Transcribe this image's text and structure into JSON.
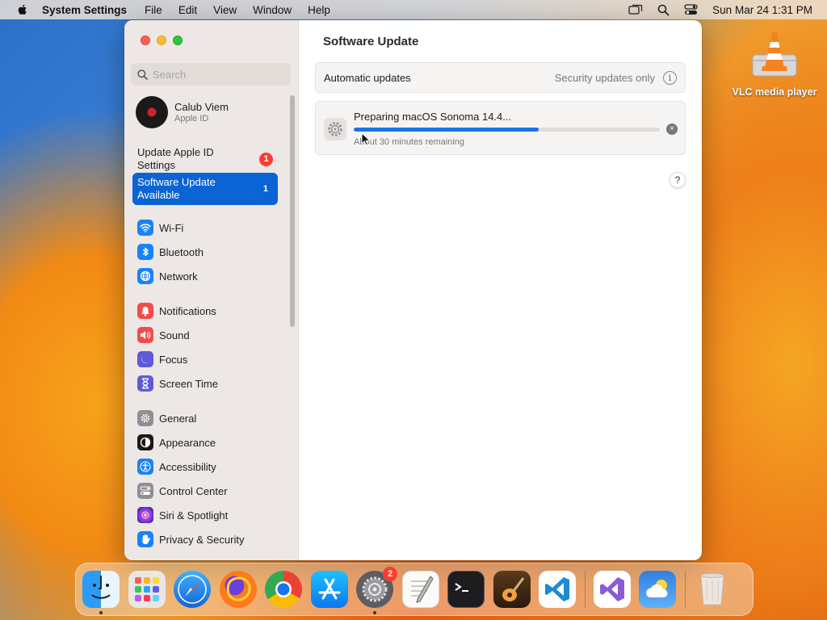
{
  "menubar": {
    "app_name": "System Settings",
    "items": [
      "File",
      "Edit",
      "View",
      "Window",
      "Help"
    ],
    "datetime": "Sun Mar 24  1:31 PM"
  },
  "desktop": {
    "icons": [
      {
        "label": "VLC media player",
        "icon": "vlc-cone-icon"
      }
    ]
  },
  "window": {
    "search_placeholder": "Search",
    "user": {
      "name": "Calub Viem",
      "subtitle": "Apple ID"
    },
    "notices": [
      {
        "label": "Update Apple ID Settings",
        "badge": "1"
      },
      {
        "label": "Software Update Available",
        "badge": "1",
        "selected": true
      }
    ],
    "nav_groups": [
      [
        {
          "label": "Wi-Fi",
          "icon": "wifi-icon",
          "color": "#1a82f7"
        },
        {
          "label": "Bluetooth",
          "icon": "bluetooth-icon",
          "color": "#1a82f7"
        },
        {
          "label": "Network",
          "icon": "globe-icon",
          "color": "#1a82f7"
        }
      ],
      [
        {
          "label": "Notifications",
          "icon": "bell-icon",
          "color": "#f44a48"
        },
        {
          "label": "Sound",
          "icon": "speaker-icon",
          "color": "#f44a48"
        },
        {
          "label": "Focus",
          "icon": "moon-icon",
          "color": "#5f5ad6"
        },
        {
          "label": "Screen Time",
          "icon": "hourglass-icon",
          "color": "#5f5ad6"
        }
      ],
      [
        {
          "label": "General",
          "icon": "gear-icon",
          "color": "#8e8e93"
        },
        {
          "label": "Appearance",
          "icon": "appearance-icon",
          "color": "#1a1a1a"
        },
        {
          "label": "Accessibility",
          "icon": "accessibility-icon",
          "color": "#1a82f7"
        },
        {
          "label": "Control Center",
          "icon": "toggles-icon",
          "color": "#8e8e93"
        },
        {
          "label": "Siri & Spotlight",
          "icon": "siri-icon",
          "color": "#b33ac7"
        },
        {
          "label": "Privacy & Security",
          "icon": "hand-icon",
          "color": "#1a82f7"
        }
      ]
    ],
    "main": {
      "title": "Software Update",
      "auto_updates": {
        "label": "Automatic updates",
        "value": "Security updates only",
        "info": "i"
      },
      "progress": {
        "title": "Preparing macOS Sonoma 14.4...",
        "fraction": 0.605,
        "subtitle": "About 30 minutes remaining",
        "cancel": "×"
      },
      "help": "?"
    }
  },
  "dock": {
    "apps": [
      {
        "name": "Finder",
        "icon": "finder-icon",
        "running": true
      },
      {
        "name": "Launchpad",
        "icon": "launchpad-icon"
      },
      {
        "name": "Safari",
        "icon": "safari-icon"
      },
      {
        "name": "Firefox",
        "icon": "firefox-icon"
      },
      {
        "name": "Chrome",
        "icon": "chrome-icon"
      },
      {
        "name": "App Store",
        "icon": "appstore-icon"
      },
      {
        "name": "System Settings",
        "icon": "system-settings-icon",
        "running": true,
        "badge": "2"
      },
      {
        "name": "TextEdit",
        "icon": "textedit-icon"
      },
      {
        "name": "Terminal",
        "icon": "terminal-icon"
      },
      {
        "name": "GarageBand",
        "icon": "garageband-icon"
      },
      {
        "name": "Visual Studio Code",
        "icon": "vscode-icon"
      },
      {
        "name": "Visual Studio",
        "icon": "visual-studio-icon"
      },
      {
        "name": "Weather",
        "icon": "weather-icon"
      },
      {
        "name": "Trash",
        "icon": "trash-icon"
      }
    ]
  }
}
